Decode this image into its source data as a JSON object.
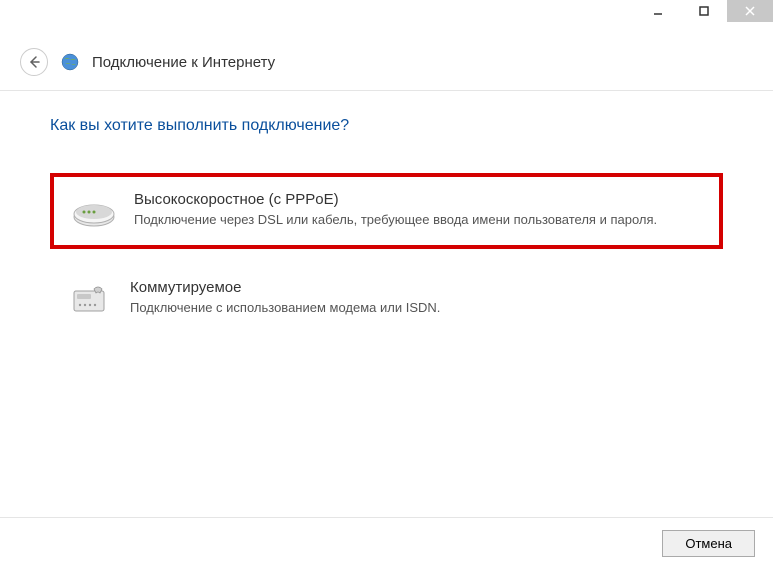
{
  "header": {
    "title": "Подключение к Интернету"
  },
  "content": {
    "question": "Как вы хотите выполнить подключение?",
    "options": [
      {
        "title": "Высокоскоростное (с PPPoE)",
        "description": "Подключение через DSL или кабель, требующее ввода имени пользователя и пароля."
      },
      {
        "title": "Коммутируемое",
        "description": "Подключение с использованием модема или ISDN."
      }
    ]
  },
  "footer": {
    "cancel_label": "Отмена"
  }
}
